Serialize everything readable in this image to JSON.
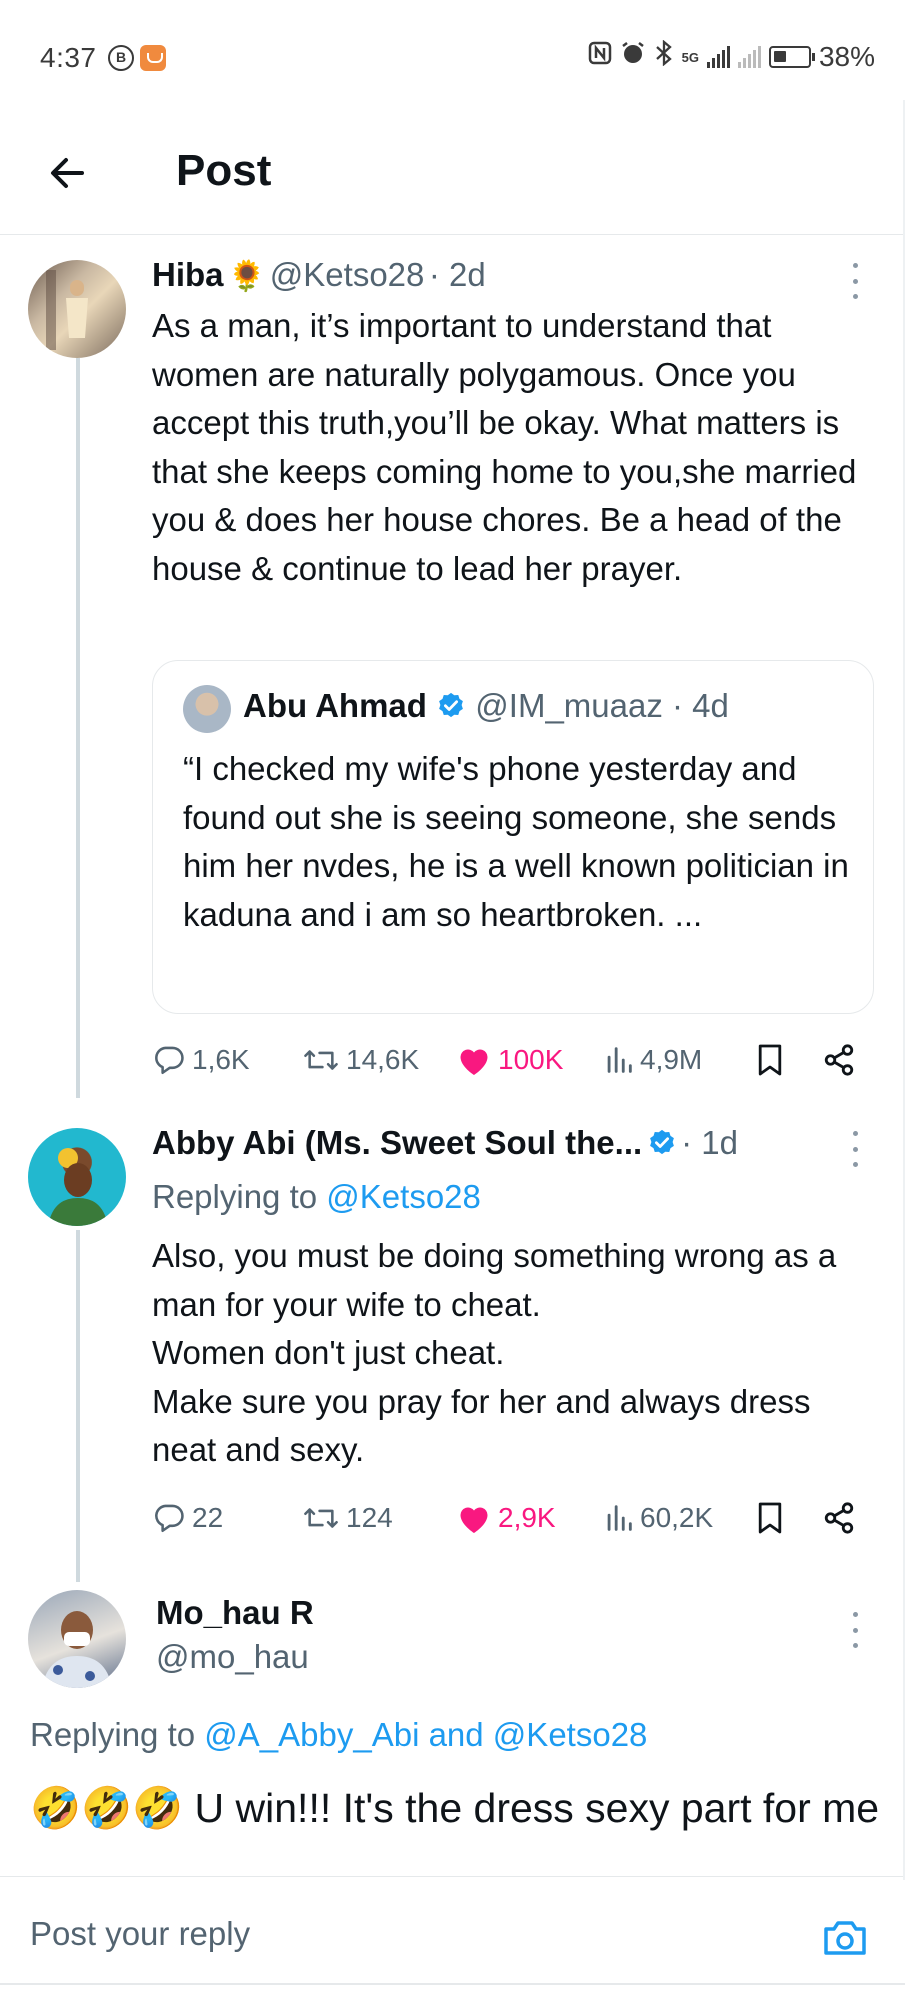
{
  "status_bar": {
    "time": "4:37",
    "b_badge": "B",
    "network_label": "5G",
    "battery": "38%"
  },
  "header": {
    "title": "Post"
  },
  "tweets": [
    {
      "name": "Hiba",
      "emoji": "🌻",
      "handle": "@Ketso28",
      "time": "· 2d",
      "text": "As a man, it’s important to understand that women are naturally polygamous. Once you accept this truth,you’ll be okay. What matters is that she keeps coming home to you,she married you & does her house chores. Be a head of the house & continue to lead her prayer.",
      "quote": {
        "name": "Abu Ahmad",
        "handle": "@IM_muaaz",
        "time": "· 4d",
        "text": "“I checked my wife's phone yesterday and found out she is seeing someone, she sends him her nvdes, he is a well known politician in kaduna and i am so heartbroken. ..."
      },
      "stats": {
        "replies": "1,6K",
        "reposts": "14,6K",
        "likes": "100K",
        "views": "4,9M"
      }
    },
    {
      "name": "Abby Abi (Ms. Sweet Soul the...",
      "time": "· 1d",
      "replying_prefix": "Replying to",
      "replying_to": "@Ketso28",
      "text": "Also, you must be doing something wrong as a man for your wife to cheat.\nWomen don't just cheat.\nMake sure you pray for her and always dress neat and sexy.",
      "stats": {
        "replies": "22",
        "reposts": "124",
        "likes": "2,9K",
        "views": "60,2K"
      }
    },
    {
      "name": "Mo_hau R",
      "handle": "@mo_hau",
      "replying_prefix": "Replying to",
      "replying_to": "@A_Abby_Abi and @Ketso28",
      "text": "🤣🤣🤣 U win!!! It's the dress sexy part for me"
    }
  ],
  "composer": {
    "placeholder": "Post your reply"
  },
  "colors": {
    "accent": "#1d9bf0",
    "like": "#f91880",
    "muted": "#536471",
    "text": "#0f1419"
  }
}
